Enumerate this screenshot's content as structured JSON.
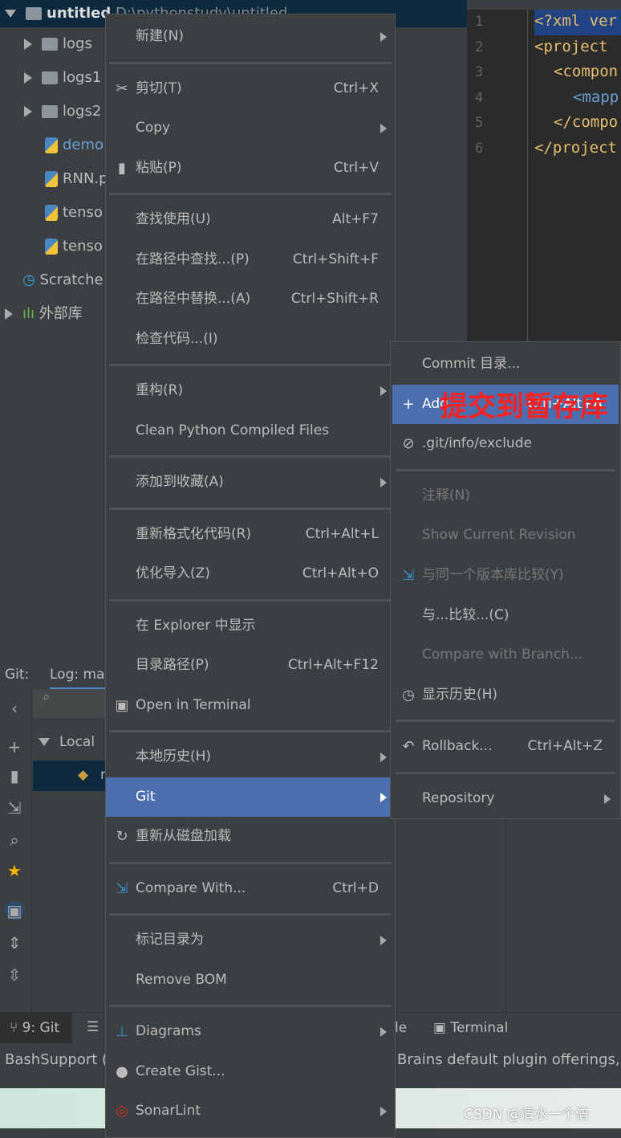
{
  "tree": {
    "root": "untitled",
    "root_path": "D:\\pythonstudy\\untitled",
    "items": [
      "logs",
      "logs1",
      "logs2",
      "demo",
      "RNN.p",
      "tenso",
      "tenso",
      "Scratche",
      "外部库"
    ]
  },
  "editor": {
    "line_numbers": [
      "1",
      "2",
      "3",
      "4",
      "5",
      "6"
    ],
    "lines": [
      "<?xml ver",
      "<project",
      "<compon",
      "<mapp",
      "</compo",
      "</project"
    ]
  },
  "git_panel": {
    "label": "Git:",
    "tab": "Log: ma",
    "local": "Local",
    "branch": "r"
  },
  "bottom_bar": {
    "git_tab": "9: Git",
    "le": "le",
    "terminal": "Terminal"
  },
  "status": {
    "left": "BashSupport (S",
    "right": "Brains default plugin offerings, a"
  },
  "watermark": "CSDN @清水一个僧",
  "annotation": "提交到暂存库",
  "context_menu": [
    {
      "label": "新建(N)",
      "submenu": true
    },
    {
      "sep": true
    },
    {
      "label": "剪切(T)",
      "shortcut": "Ctrl+X",
      "icon": "scissors-icon"
    },
    {
      "label": "Copy",
      "submenu": true
    },
    {
      "label": "粘贴(P)",
      "shortcut": "Ctrl+V",
      "icon": "clipboard-icon"
    },
    {
      "sep": true
    },
    {
      "label": "查找使用(U)",
      "shortcut": "Alt+F7"
    },
    {
      "label": "在路径中查找...(P)",
      "shortcut": "Ctrl+Shift+F"
    },
    {
      "label": "在路径中替换...(A)",
      "shortcut": "Ctrl+Shift+R"
    },
    {
      "label": "检查代码...(I)"
    },
    {
      "sep": true
    },
    {
      "label": "重构(R)",
      "submenu": true
    },
    {
      "label": "Clean Python Compiled Files"
    },
    {
      "sep": true
    },
    {
      "label": "添加到收藏(A)",
      "submenu": true
    },
    {
      "sep": true
    },
    {
      "label": "重新格式化代码(R)",
      "shortcut": "Ctrl+Alt+L"
    },
    {
      "label": "优化导入(Z)",
      "shortcut": "Ctrl+Alt+O"
    },
    {
      "sep": true
    },
    {
      "label": "在 Explorer 中显示"
    },
    {
      "label": "目录路径(P)",
      "shortcut": "Ctrl+Alt+F12"
    },
    {
      "label": "Open in Terminal",
      "icon": "terminal-icon"
    },
    {
      "sep": true
    },
    {
      "label": "本地历史(H)",
      "submenu": true
    },
    {
      "label": "Git",
      "submenu": true,
      "selected": true
    },
    {
      "label": "重新从磁盘加载",
      "icon": "reload-icon"
    },
    {
      "sep": true
    },
    {
      "label": "Compare With...",
      "shortcut": "Ctrl+D",
      "icon": "compare-icon"
    },
    {
      "sep": true
    },
    {
      "label": "标记目录为",
      "submenu": true
    },
    {
      "label": "Remove BOM"
    },
    {
      "sep": true
    },
    {
      "label": "Diagrams",
      "submenu": true,
      "icon": "diagram-icon"
    },
    {
      "label": "Create Gist...",
      "icon": "github-icon"
    },
    {
      "label": "SonarLint",
      "submenu": true,
      "icon": "sonarlint-icon"
    }
  ],
  "git_submenu": [
    {
      "label": "Commit 目录..."
    },
    {
      "label": "Add",
      "shortcut": "Ctrl+Alt+A",
      "icon": "plus-icon",
      "selected": true
    },
    {
      "label": ".git/info/exclude",
      "icon": "exclude-file-icon"
    },
    {
      "sep": true
    },
    {
      "label": "注释(N)",
      "disabled": true
    },
    {
      "label": "Show Current Revision",
      "disabled": true
    },
    {
      "label": "与同一个版本库比较(Y)",
      "disabled": true,
      "icon": "compare-icon"
    },
    {
      "label": "与...比较...(C)"
    },
    {
      "label": "Compare with Branch...",
      "disabled": true
    },
    {
      "label": "显示历史(H)",
      "icon": "clock-icon"
    },
    {
      "sep": true
    },
    {
      "label": "Rollback...",
      "shortcut": "Ctrl+Alt+Z",
      "icon": "rollback-icon"
    },
    {
      "sep": true
    },
    {
      "label": "Repository",
      "submenu": true
    }
  ],
  "colors": {
    "selection": "#4b6eaf",
    "menu_bg": "#3c3f41",
    "annotation": "#ff2020"
  }
}
